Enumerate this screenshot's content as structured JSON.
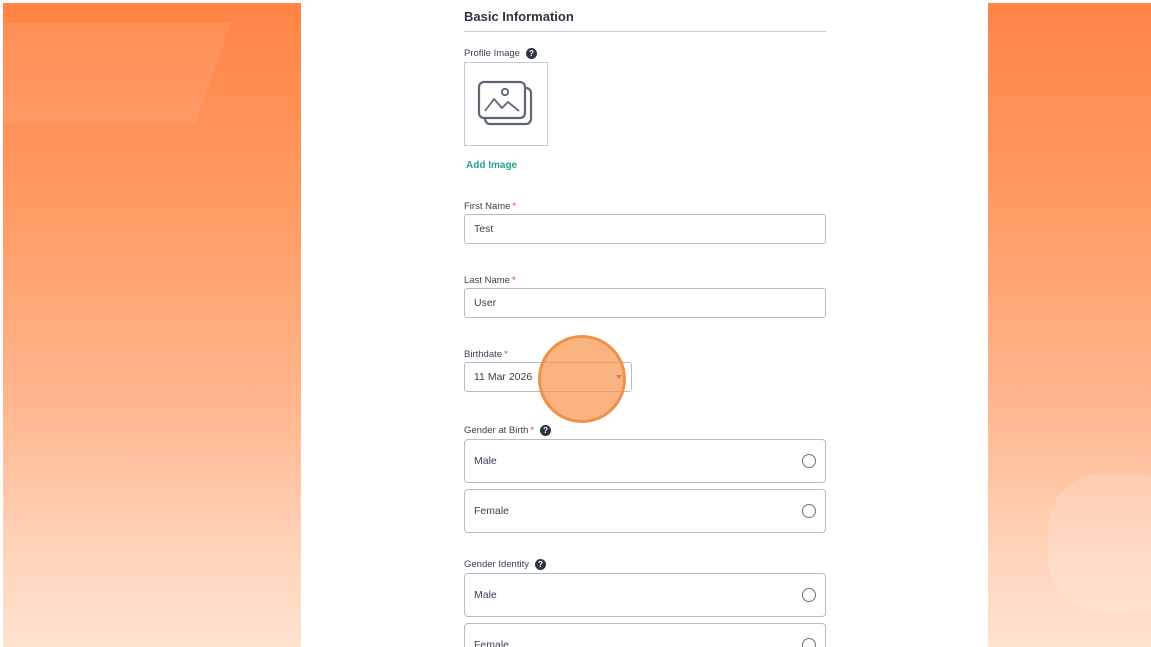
{
  "form": {
    "section_title": "Basic Information",
    "profile_image": {
      "label": "Profile Image",
      "help_icon": "question-circle-icon",
      "placeholder_icon": "image-icon",
      "add_label": "Add Image"
    },
    "first_name": {
      "label": "First Name",
      "required": "*",
      "value": "Test"
    },
    "last_name": {
      "label": "Last Name",
      "required": "*",
      "value": "User"
    },
    "birthdate": {
      "label": "Birthdate",
      "required": "*",
      "value": "11 Mar 2026"
    },
    "gender_at_birth": {
      "label": "Gender at Birth",
      "required": "*",
      "options": [
        "Male",
        "Female"
      ]
    },
    "gender_identity": {
      "label": "Gender Identity",
      "options": [
        "Male",
        "Female"
      ]
    }
  },
  "colors": {
    "accent": "#2aa096",
    "required": "#e23c3c",
    "highlight": "#f59650",
    "background_gradient_top": "#ff8445"
  }
}
